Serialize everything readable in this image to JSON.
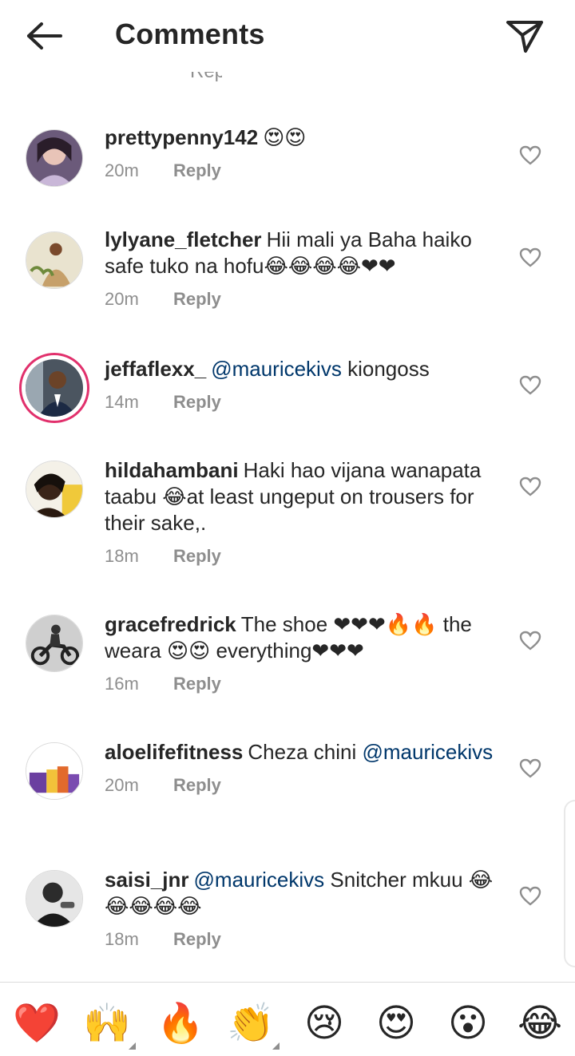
{
  "header": {
    "title": "Comments",
    "back_icon": "arrow-left-icon",
    "share_icon": "paper-plane-icon"
  },
  "partial_text": "Reply",
  "comments": [
    {
      "username": "prettypenny142",
      "mention": "",
      "text": "😍😍",
      "time": "20m",
      "reply": "Reply"
    },
    {
      "username": "lylyane_fletcher",
      "mention": "",
      "text": "Hii mali ya Baha haiko safe tuko na hofu😂😂😂😂❤❤",
      "time": "20m",
      "reply": "Reply"
    },
    {
      "username": "jeffaflexx_",
      "mention": "@mauricekivs",
      "text": "kiongoss",
      "time": "14m",
      "reply": "Reply"
    },
    {
      "username": "hildahambani",
      "mention": "",
      "text": "Haki hao vijana wanapata taabu 😂at least ungeput on trousers for their sake,.",
      "time": "18m",
      "reply": "Reply"
    },
    {
      "username": "gracefredrick",
      "mention": "",
      "text": "The shoe ❤❤❤🔥🔥 the weara 😍😍 everything❤❤❤",
      "time": "16m",
      "reply": "Reply"
    },
    {
      "username": "aloelifefitness",
      "mention": "",
      "text": "Cheza chini",
      "mention_after": "@mauricekivs",
      "time": "20m",
      "reply": "Reply"
    },
    {
      "username": "saisi_jnr",
      "mention": "@mauricekivs",
      "text": "Snitcher mkuu 😂😂😂😂😂",
      "time": "18m",
      "reply": "Reply"
    }
  ],
  "reactions": [
    "❤️",
    "🙌",
    "🔥",
    "👏",
    "😢",
    "😍",
    "😮",
    "😂"
  ],
  "colors": {
    "mention": "#00376b",
    "meta": "#8e8e8e",
    "story_ring": "#e1306c"
  }
}
